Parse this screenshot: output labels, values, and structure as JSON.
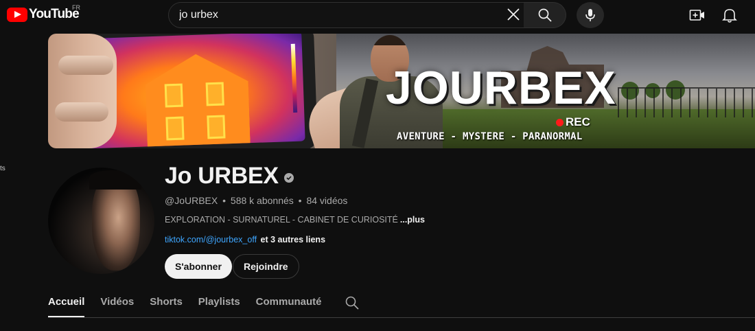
{
  "header": {
    "logo_text": "YouTube",
    "country_code": "FR",
    "search": {
      "value": "jo urbex"
    },
    "icons": [
      "youtube-logo-icon",
      "clear-icon",
      "search-icon",
      "microphone-icon",
      "create-video-icon",
      "bell-icon"
    ]
  },
  "sidebar": {
    "fragment_text": "ts"
  },
  "banner": {
    "title": "JOURBEX",
    "rec_label": "REC",
    "tagline": "AVENTURE - MYSTERE - PARANORMAL"
  },
  "channel": {
    "name": "Jo URBEX",
    "handle": "@JoURBEX",
    "subscribers": "588 k abonnés",
    "video_count": "84 vidéos",
    "separator": "•",
    "description": "EXPLORATION - SURNATUREL - CABINET DE CURIOSITÉ",
    "description_more": "...plus",
    "link": "tiktok.com/@jourbex_off",
    "links_more": "et 3 autres liens",
    "subscribe_label": "S'abonner",
    "join_label": "Rejoindre"
  },
  "tabs": [
    {
      "label": "Accueil",
      "active": true
    },
    {
      "label": "Vidéos",
      "active": false
    },
    {
      "label": "Shorts",
      "active": false
    },
    {
      "label": "Playlists",
      "active": false
    },
    {
      "label": "Communauté",
      "active": false
    }
  ],
  "colors": {
    "background": "#0f0f0f",
    "brand_red": "#ff0000",
    "link_blue": "#3ea6ff",
    "text_primary": "#f1f1f1",
    "text_secondary": "#aaaaaa"
  }
}
